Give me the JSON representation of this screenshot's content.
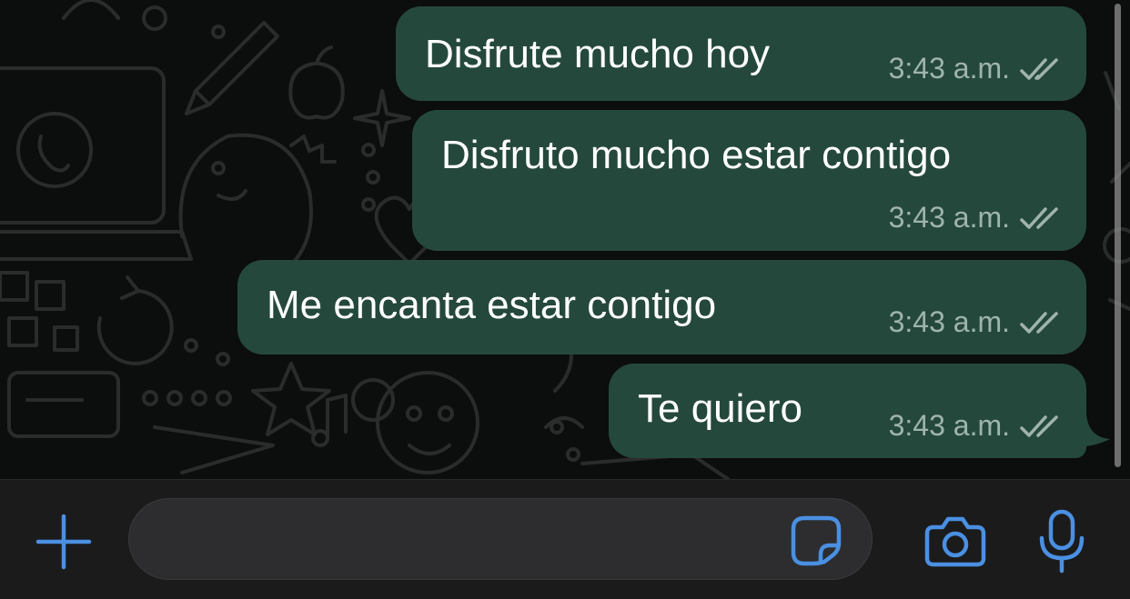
{
  "chat": {
    "messages": [
      {
        "text": "Disfrute mucho hoy",
        "time": "3:43 a.m.",
        "status": "double-check-icon"
      },
      {
        "text": "Disfruto mucho estar contigo",
        "time": "3:43 a.m.",
        "status": "double-check-icon"
      },
      {
        "text": "Me encanta estar contigo",
        "time": "3:43 a.m.",
        "status": "double-check-icon"
      },
      {
        "text": "Te quiero",
        "time": "3:43 a.m.",
        "status": "double-check-icon"
      }
    ]
  },
  "composer": {
    "message_value": "",
    "icons": {
      "attach": "plus-icon",
      "sticker": "sticker-icon",
      "camera": "camera-icon",
      "voice": "microphone-icon"
    }
  },
  "colors": {
    "outgoing_bubble": "#25483d",
    "accent": "#4a90e2",
    "chat_background": "#0c0d0d",
    "composer_background": "#1b1b1c"
  }
}
